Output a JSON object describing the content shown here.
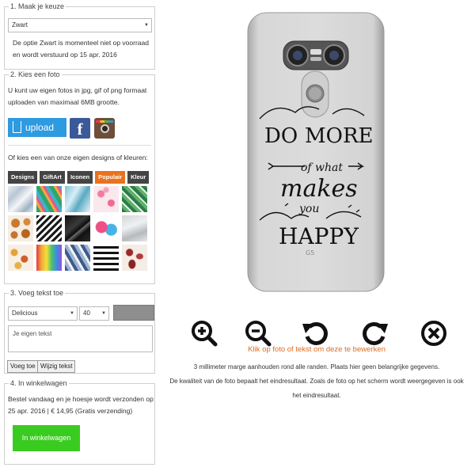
{
  "step1": {
    "legend": "1. Maak je keuze",
    "color_select": "Zwart",
    "stock_note_1": "De optie Zwart is momenteel niet op voorraad",
    "stock_note_2": "en wordt verstuurd op 15 apr. 2016"
  },
  "step2": {
    "legend": "2. Kies een foto",
    "desc_1": "U kunt uw eigen fotos in jpg, gif of png formaat",
    "desc_2": "uploaden van maximaal 6MB grootte.",
    "upload_label": "upload",
    "designs_prompt": "Of kies een van onze eigen designs of kleuren:",
    "tabs": [
      "Designs",
      "GiftArt",
      "Iconen",
      "Populair",
      "Kleur"
    ],
    "active_tab": "Populair",
    "thumbnail_count": 15
  },
  "step3": {
    "legend": "3. Voeg tekst toe",
    "font_select": "Delicious",
    "size_select": "40",
    "text_placeholder": "Je eigen tekst",
    "add_button": "Voeg toe",
    "edit_button": "Wijzig tekst",
    "text_color": "#8e8e8e"
  },
  "step4": {
    "legend": "4. In winkelwagen",
    "order_line_1": "Bestel vandaag en je hoesje wordt verzonden op",
    "order_line_2": "25 apr. 2016 | € 14,95 (Gratis verzending)",
    "cart_button": "In winkelwagen"
  },
  "preview": {
    "phone_model_label": "G5",
    "design_text": [
      "DO",
      "MORE",
      "of what",
      "makes",
      "you",
      "HAPPY"
    ],
    "controls": [
      "zoom-in-icon",
      "zoom-out-icon",
      "rotate-left-icon",
      "rotate-right-icon",
      "delete-icon"
    ],
    "edit_hint": "Klik op foto of tekst om deze te bewerken",
    "margin_note": "3 millimeter marge aanhouden rond alle randen. Plaats hier geen belangrijke gegevens.",
    "quality_note_1": "De kwaliteit van de foto bepaalt het eindresultaat. Zoals de foto op het scherm wordt weergegeven is ook",
    "quality_note_2": "het eindresultaat."
  },
  "colors": {
    "upload_blue": "#2e9ae0",
    "active_tab_orange": "#e9721e",
    "cart_green": "#3acb20",
    "hint_orange": "#e06b1e"
  }
}
